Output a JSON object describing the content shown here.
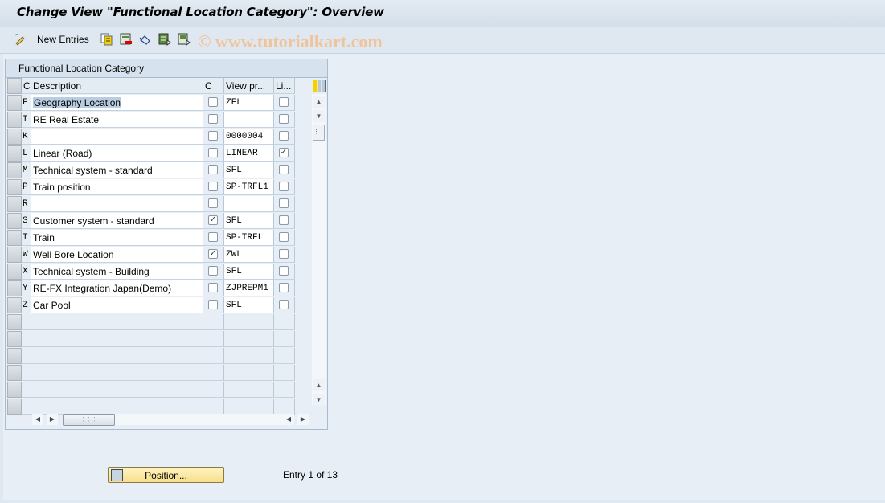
{
  "window": {
    "title": "Change View \"Functional Location Category\": Overview"
  },
  "toolbar": {
    "items": [
      {
        "icon": "change-display-icon",
        "label": ""
      },
      {
        "icon": "new-entries",
        "label": "New Entries"
      },
      {
        "icon": "copy-as-icon",
        "label": ""
      },
      {
        "icon": "delete-icon",
        "label": ""
      },
      {
        "icon": "undo-change-icon",
        "label": ""
      },
      {
        "icon": "select-all-icon",
        "label": ""
      },
      {
        "icon": "select-block-icon",
        "label": ""
      }
    ],
    "watermark": "© www.tutorialkart.com"
  },
  "table": {
    "title": "Functional Location Category",
    "columns": {
      "key": "C",
      "description": "Description",
      "chk": "C",
      "view": "View pr...",
      "li": "Li..."
    },
    "rows": [
      {
        "key": "F",
        "description": "Geography Location",
        "chk": false,
        "view": "ZFL",
        "li": false,
        "selected": true
      },
      {
        "key": "I",
        "description": "RE Real Estate",
        "chk": false,
        "view": "",
        "li": false
      },
      {
        "key": "K",
        "description": "",
        "chk": false,
        "view": "0000004",
        "li": false
      },
      {
        "key": "L",
        "description": "Linear (Road)",
        "chk": false,
        "view": "LINEAR",
        "li": true
      },
      {
        "key": "M",
        "description": "Technical system - standard",
        "chk": false,
        "view": "SFL",
        "li": false
      },
      {
        "key": "P",
        "description": "Train position",
        "chk": false,
        "view": "SP-TRFL1",
        "li": false
      },
      {
        "key": "R",
        "description": "",
        "chk": false,
        "view": "",
        "li": false
      },
      {
        "key": "S",
        "description": "Customer system - standard",
        "chk": true,
        "view": "SFL",
        "li": false
      },
      {
        "key": "T",
        "description": "Train",
        "chk": false,
        "view": "SP-TRFL",
        "li": false
      },
      {
        "key": "W",
        "description": "Well Bore Location",
        "chk": true,
        "view": "ZWL",
        "li": false
      },
      {
        "key": "X",
        "description": "Technical system - Building",
        "chk": false,
        "view": "SFL",
        "li": false
      },
      {
        "key": "Y",
        "description": "RE-FX Integration Japan(Demo)",
        "chk": false,
        "view": "ZJPREPM1",
        "li": false
      },
      {
        "key": "Z",
        "description": "Car Pool",
        "chk": false,
        "view": "SFL",
        "li": false
      }
    ],
    "empty_rows": 6
  },
  "footer": {
    "position_button": "Position...",
    "entry_status": "Entry 1 of 13"
  }
}
